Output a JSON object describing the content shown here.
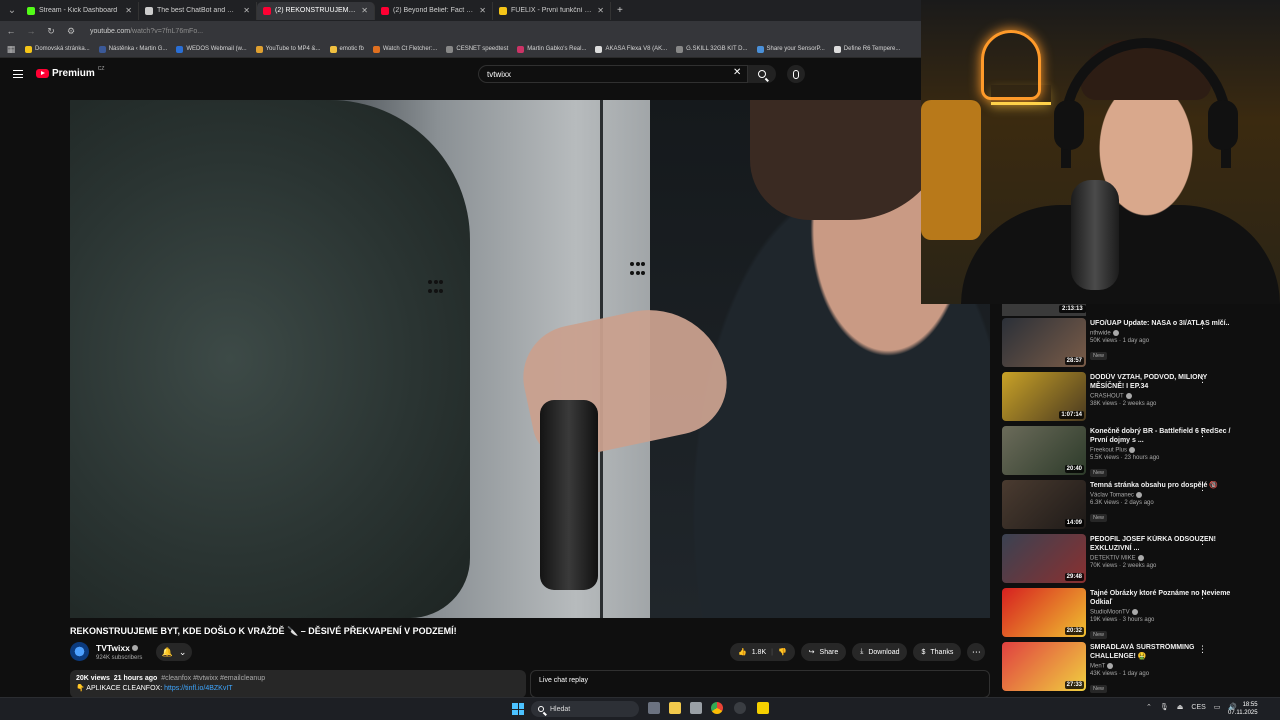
{
  "browser": {
    "tabs": [
      {
        "title": "Stream - Kick Dashboard",
        "color": "#53fc18",
        "active": false
      },
      {
        "title": "The best ChatBot and Widgets",
        "color": "#cccccc",
        "active": false
      },
      {
        "title": "(2) REKONSTRUUJEME BYT, KDE...",
        "color": "#ff0033",
        "active": true
      },
      {
        "title": "(2) Beyond Belief: Fact or Fiction",
        "color": "#ff0033",
        "active": false
      },
      {
        "title": "FUELIX - První funkční nápoj pro...",
        "color": "#f5c518",
        "active": false
      }
    ],
    "url_host": "youtube.com",
    "url_path": "/watch?v=7fnL76mFo...",
    "bookmarks": [
      {
        "label": "Domovská stránka...",
        "color": "#f5c518"
      },
      {
        "label": "Nástěnka ‹ Martin G...",
        "color": "#3b5998"
      },
      {
        "label": "WEDOS Webmail (w...",
        "color": "#2a6fd6"
      },
      {
        "label": "YouTube to MP4 &...",
        "color": "#e0a030"
      },
      {
        "label": "emotic fb",
        "color": "#f0c040"
      },
      {
        "label": "Watch Ct Fletcher:...",
        "color": "#e07020"
      },
      {
        "label": "CESNET speedtest",
        "color": "#888888"
      },
      {
        "label": "Martin Gabko's Real...",
        "color": "#cc3366"
      },
      {
        "label": "AKASA Flexa V8 (AK...",
        "color": "#dddddd"
      },
      {
        "label": "G.SKILL 32GB KIT D...",
        "color": "#888888"
      },
      {
        "label": "Share your SensorP...",
        "color": "#4a90d9"
      },
      {
        "label": "Define R6 Tempere...",
        "color": "#dddddd"
      }
    ]
  },
  "youtube": {
    "logo_text": "Premium",
    "logo_region": "CZ",
    "search_value": "tvtwixx",
    "video_title": "REKONSTRUUJEME BYT, KDE DOŠLO K VRAŽDĚ 🔪 – DĚSIVÉ PŘEKVAPENÍ V PODZEMÍ!",
    "channel_name": "TVTwixx",
    "channel_subs": "924K subscribers",
    "likes": "1.8K",
    "share_label": "Share",
    "download_label": "Download",
    "thanks_label": "Thanks",
    "views": "20K views",
    "age": "21 hours ago",
    "tags": "#cleanfox #tvtwixx #emailcleanup",
    "desc_line": "👇 APLIKACE CLEANFOX:",
    "desc_link": "https://tinfl.io/4BZKvIT",
    "live_chat_label": "Live chat replay"
  },
  "recommendations": {
    "prev_duration": "2:13:13",
    "items": [
      {
        "title": "UFO/UAP Update: NASA o 3I/ATLAS mlčí..",
        "channel": "nthwide",
        "views": "50K views · 1 day ago",
        "new": "New",
        "duration": "28:57",
        "c1": "#2b3038",
        "c2": "#7a5c48"
      },
      {
        "title": "DODŮV VZTAH, PODVOD, MILIONY MĚSÍČNĚ! I EP.34",
        "channel": "CRASHOUT",
        "views": "38K views · 2 weeks ago",
        "new": "",
        "duration": "1:07:14",
        "c1": "#c9a227",
        "c2": "#4a3a20"
      },
      {
        "title": "Konečně dobrý BR - Battlefield 6 RedSec / První dojmy s ...",
        "channel": "Freekout Plus",
        "views": "5.5K views · 23 hours ago",
        "new": "New",
        "duration": "20:40",
        "c1": "#6b6b5a",
        "c2": "#2d3b2a"
      },
      {
        "title": "Temná stránka obsahu pro dospělé 🔞",
        "channel": "Václav Tomanec",
        "views": "6.3K views · 2 days ago",
        "new": "New",
        "duration": "14:09",
        "c1": "#4a3b30",
        "c2": "#1e1a18"
      },
      {
        "title": "PEDOFIL JOSEF KŮRKA ODSOUZEN! EXKLUZIVNÍ ...",
        "channel": "DETEKTIV MIKE",
        "views": "70K views · 2 weeks ago",
        "new": "",
        "duration": "29:48",
        "c1": "#3a4252",
        "c2": "#8a3030"
      },
      {
        "title": "Tajné Obrázky ktoré Poznáme no Nevieme Odkiaľ",
        "channel": "StudioMoonTV",
        "views": "19K views · 3 hours ago",
        "new": "New",
        "duration": "20:32",
        "c1": "#d62020",
        "c2": "#f0c030"
      },
      {
        "title": "SMRADLAVÁ SURSTRÖMMING CHALLENGE! 🤮",
        "channel": "MenT",
        "views": "43K views · 1 day ago",
        "new": "New",
        "duration": "27:33",
        "c1": "#e04040",
        "c2": "#f0d040"
      }
    ]
  },
  "taskbar": {
    "search_placeholder": "Hledat",
    "lang": "CES",
    "time": "18:55",
    "date": "07.11.2025"
  }
}
